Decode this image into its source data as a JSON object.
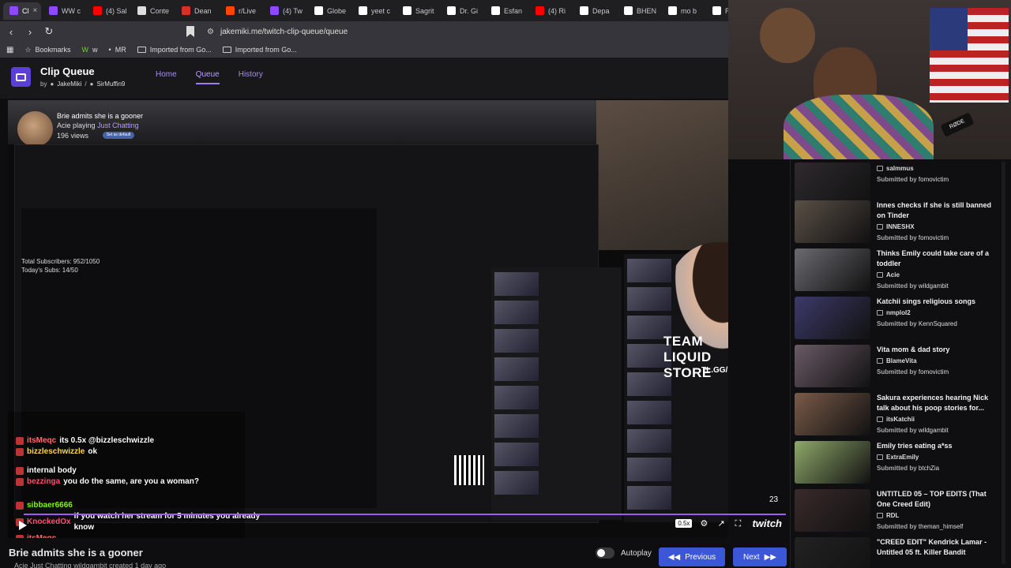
{
  "browser": {
    "tabs": [
      {
        "label": "Cl",
        "icon": "twitch-icon",
        "color": "#9146ff",
        "active": true
      },
      {
        "label": "WW c",
        "icon": "twitch-icon",
        "color": "#9146ff"
      },
      {
        "label": "(4) Sal",
        "icon": "youtube-icon",
        "color": "#ff0000"
      },
      {
        "label": "Conte",
        "icon": "page-icon",
        "color": "#dddddd"
      },
      {
        "label": "Dean",
        "icon": "chart-icon",
        "color": "#d93025"
      },
      {
        "label": "r/Live",
        "icon": "reddit-icon",
        "color": "#ff4500"
      },
      {
        "label": "(4) Tw",
        "icon": "twitch-icon",
        "color": "#9146ff"
      },
      {
        "label": "Globe",
        "icon": "x-icon",
        "color": "#ffffff"
      },
      {
        "label": "yeet c",
        "icon": "x-icon",
        "color": "#ffffff"
      },
      {
        "label": "Sagrit",
        "icon": "x-icon",
        "color": "#ffffff"
      },
      {
        "label": "Dr. Gi",
        "icon": "x-icon",
        "color": "#ffffff"
      },
      {
        "label": "Esfan",
        "icon": "x-icon",
        "color": "#ffffff"
      },
      {
        "label": "(4) Ri",
        "icon": "youtube-icon",
        "color": "#ff0000"
      },
      {
        "label": "Depa",
        "icon": "x-icon",
        "color": "#ffffff"
      },
      {
        "label": "BHEN",
        "icon": "x-icon",
        "color": "#ffffff"
      },
      {
        "label": "mo b",
        "icon": "google-icon",
        "color": "#ffffff"
      },
      {
        "label": "RAY S",
        "icon": "tiktok-icon",
        "color": "#ffffff"
      }
    ],
    "url": "jakemiki.me/twitch-clip-queue/queue",
    "bookmarks": [
      {
        "label": "Bookmarks",
        "icon": "bookmarks-icon"
      },
      {
        "label": "w",
        "icon": "w-icon"
      },
      {
        "label": "MR",
        "icon": "mr-icon"
      },
      {
        "label": "Imported from Go...",
        "icon": "folder-icon"
      },
      {
        "label": "Imported from Go...",
        "icon": "folder-icon"
      }
    ]
  },
  "site": {
    "title": "Clip Queue",
    "by": "by",
    "author1": "JakeMiki",
    "author2": "SirMuffin9",
    "nav": [
      "Home",
      "Queue",
      "History"
    ],
    "accent": "#9b7ff0"
  },
  "current_clip": {
    "title": "Brie admits she is a gooner",
    "channel": "Acie",
    "playing": "playing",
    "category": "Just Chatting",
    "views": "196 views",
    "default_label": "Set as default",
    "sidebar_label_top": "Team Liquid Store",
    "sidebar_label_sub": "TL.GG/STORE",
    "sub_counter_1": "Total Subscribers: 952/1050",
    "sub_counter_2": "Today's Subs: 14/50",
    "counter": "23"
  },
  "chat": [
    {
      "user": "itsMeqc",
      "color": "#ff6b6b",
      "msg": "its 0.5x @bizzleschwizzle"
    },
    {
      "user": "bizzleschwizzle",
      "color": "#ffd54a",
      "msg": "ok"
    },
    {
      "user": "",
      "color": "#ff6b6b",
      "msg": "internal body"
    },
    {
      "user": "bezzinga",
      "color": "#ff4d6d",
      "msg": "you do the same, are you a woman?"
    },
    {
      "user": "sibbaer6666",
      "color": "#7cfc00",
      "msg": ""
    },
    {
      "user": "KnockedOx",
      "color": "#ff4d6d",
      "msg": "if you watch her stream for 5 minutes you already know"
    },
    {
      "user": "itsMeqc",
      "color": "#ff6b6b",
      "msg": ""
    }
  ],
  "player": {
    "speed": "0.5x",
    "brand": "twitch"
  },
  "bottom": {
    "title": "Brie admits she is a gooner",
    "meta_channel": "Acie",
    "meta_playing": "Just Chatting",
    "meta_submitted": "wildgambit",
    "meta_created": "created 1 day ago",
    "autoplay": "Autoplay",
    "prev": "Previous",
    "next": "Next"
  },
  "queue": [
    {
      "title": "salmmus",
      "author": "salmmus",
      "submitter": "fomovictim",
      "thumb": "#2e2a2e"
    },
    {
      "title": "Innes checks if she is still banned on Tinder",
      "author": "INNESHX",
      "submitter": "fomovictim",
      "thumb": "#5a4f46"
    },
    {
      "title": "Thinks Emily could take care of a toddler",
      "author": "Acie",
      "submitter": "wildgambit",
      "thumb": "#6b6a70"
    },
    {
      "title": "Katchii sings religious songs",
      "author": "nmplol2",
      "submitter": "KennSquared",
      "thumb": "#3c3a6a"
    },
    {
      "title": "Vita mom & dad story",
      "author": "BlameVita",
      "submitter": "fomovictim",
      "thumb": "#6a5a66"
    },
    {
      "title": "Sakura experiences hearing Nick talk about his poop stories for...",
      "author": "itsKatchii",
      "submitter": "wildgambit",
      "thumb": "#7a5a48"
    },
    {
      "title": "Emily tries eating a*ss",
      "author": "ExtraEmily",
      "submitter": "btchZia",
      "thumb": "#8fa86a"
    },
    {
      "title": "UNTITLED 05 – TOP EDITS (That One Creed Edit)",
      "author": "RDL",
      "submitter": "theman_himself",
      "thumb": "#3a2a2a"
    },
    {
      "title": "\"CREED EDIT\" Kendrick Lamar - Untitled 05 ft. Killer Bandit",
      "author": "",
      "submitter": "",
      "thumb": "#222222"
    }
  ],
  "webcam": {
    "mic_brand": "RØDE"
  }
}
